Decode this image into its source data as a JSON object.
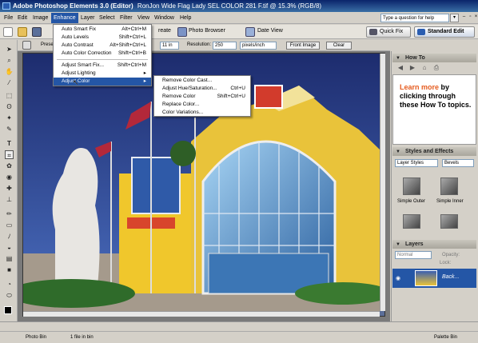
{
  "window": {
    "title": "Adobe Photoshop Elements 3.0 (Editor)",
    "doc_title": "RonJon Wide Flag Lady SEL COLOR 281 F.tif @ 15.3% (RGB/8)"
  },
  "menubar": {
    "items": [
      "File",
      "Edit",
      "Image",
      "Enhance",
      "Layer",
      "Select",
      "Filter",
      "View",
      "Window",
      "Help"
    ],
    "help_placeholder": "Type a question for help"
  },
  "toolbar": {
    "create_label": "reate",
    "photo_browser": "Photo Browser",
    "date_view": "Date View",
    "quick_fix": "Quick Fix",
    "standard_edit": "Standard Edit"
  },
  "options": {
    "preset_label": "Prese",
    "width_value": "11 in",
    "resolution_label": "Resolution:",
    "resolution_value": "250",
    "units": "pixels/inch",
    "front_image": "Front Image",
    "clear": "Clear"
  },
  "enhance_menu": {
    "items": [
      {
        "label": "Auto Smart Fix",
        "shortcut": "Alt+Ctrl+M"
      },
      {
        "label": "Auto Levels",
        "shortcut": "Shift+Ctrl+L"
      },
      {
        "label": "Auto Contrast",
        "shortcut": "Alt+Shift+Ctrl+L"
      },
      {
        "label": "Auto Color Correction",
        "shortcut": "Shift+Ctrl+B"
      },
      {
        "label": "Adjust Smart Fix...",
        "shortcut": "Shift+Ctrl+M"
      },
      {
        "label": "Adjust Lighting",
        "shortcut": "▸"
      },
      {
        "label": "Adjust Color",
        "shortcut": "▸"
      }
    ]
  },
  "adjust_color_submenu": {
    "items": [
      {
        "label": "Remove Color Cast...",
        "shortcut": ""
      },
      {
        "label": "Adjust Hue/Saturation...",
        "shortcut": "Ctrl+U"
      },
      {
        "label": "Remove Color",
        "shortcut": "Shift+Ctrl+U"
      },
      {
        "label": "Replace Color...",
        "shortcut": ""
      },
      {
        "label": "Color Variations...",
        "shortcut": ""
      }
    ]
  },
  "howto": {
    "title": "How To",
    "text_accent": "Learn more",
    "text_rest": " by clicking through these How To topics."
  },
  "styles": {
    "title": "Styles and Effects",
    "category": "Layer Styles",
    "type": "Bevels",
    "labels": [
      "Simple Outer",
      "Simple Inner"
    ]
  },
  "layers": {
    "title": "Layers",
    "blend": "Normal",
    "opacity_label": "Opacity:",
    "lock_label": "Lock:",
    "layer_name": "Back..."
  },
  "status": {
    "photo_bin": "Photo Bin",
    "files_in_bin": "1 file in bin",
    "palette_bin": "Palette Bin"
  },
  "colors": {
    "title_bar": "#0a246a",
    "highlight": "#2456a6",
    "accent_orange": "#e65c1f"
  }
}
